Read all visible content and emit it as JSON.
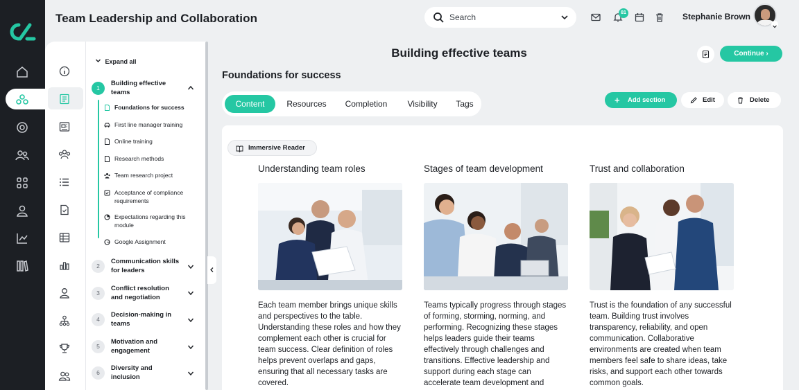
{
  "header": {
    "app_title": "Team Leadership and Collaboration",
    "search_placeholder": "Search",
    "notification_count": "81",
    "user_name": "Stephanie Brown"
  },
  "rail": {
    "icons": [
      "home-icon",
      "modules-icon",
      "target-icon",
      "people-icon",
      "grid-icon",
      "user-icon",
      "analytics-icon",
      "library-icon"
    ]
  },
  "icon_column": {
    "icons": [
      "info-icon",
      "book-icon",
      "newspaper-icon",
      "team-icon",
      "list-icon",
      "document-icon",
      "table-icon",
      "chart-icon",
      "person-icon",
      "hierarchy-icon",
      "trophy-icon",
      "group-icon"
    ]
  },
  "outline": {
    "expand_all": "Expand all",
    "modules": [
      {
        "number": "1",
        "title": "Building effective teams",
        "expanded": true
      },
      {
        "number": "2",
        "title": "Communication skills for leaders"
      },
      {
        "number": "3",
        "title": "Conflict resolution and negotiation"
      },
      {
        "number": "4",
        "title": "Decision-making in teams"
      },
      {
        "number": "5",
        "title": "Motivation and engagement"
      },
      {
        "number": "6",
        "title": "Diversity and inclusion"
      }
    ],
    "lessons": [
      {
        "label": "Foundations for success",
        "icon": "page-icon",
        "current": true
      },
      {
        "label": "First line manager training",
        "icon": "car-icon"
      },
      {
        "label": "Online training",
        "icon": "page-icon"
      },
      {
        "label": "Research methods",
        "icon": "page-icon"
      },
      {
        "label": "Team research project",
        "icon": "team-icon"
      },
      {
        "label": "Acceptance of compliance requirements",
        "icon": "checkbox-icon"
      },
      {
        "label": "Expectations regarding this module",
        "icon": "pie-icon"
      },
      {
        "label": "Google Assignment",
        "icon": "google-icon"
      }
    ]
  },
  "main": {
    "page_title": "Building effective teams",
    "continue_label": "Continue",
    "section_title": "Foundations for success",
    "tabs": [
      "Content",
      "Resources",
      "Completion",
      "Visibility",
      "Tags"
    ],
    "active_tab": "Content",
    "add_section_label": "Add section",
    "edit_label": "Edit",
    "delete_label": "Delete",
    "immersive_reader_label": "Immersive Reader",
    "columns": [
      {
        "title": "Understanding team roles",
        "text": "Each team member brings unique skills and perspectives to the table. Understanding these roles and how they complement each other is crucial for team success. Clear definition of roles helps prevent overlaps and gaps, ensuring that all necessary tasks are covered."
      },
      {
        "title": "Stages of team development",
        "text": "Teams typically progress through stages of forming, storming, norming, and performing. Recognizing these stages helps leaders guide their teams effectively through challenges and transitions. Effective leadership and support during each stage can accelerate team development and"
      },
      {
        "title": "Trust and collaboration",
        "text": "Trust is the foundation of any successful team. Building trust involves transparency, reliability, and open communication. Collaborative environments are created when team members feel safe to share ideas, take risks, and support each other towards common goals."
      }
    ]
  },
  "colors": {
    "accent": "#25c7a3",
    "rail": "#1c1f24",
    "background": "#eef0f2"
  }
}
